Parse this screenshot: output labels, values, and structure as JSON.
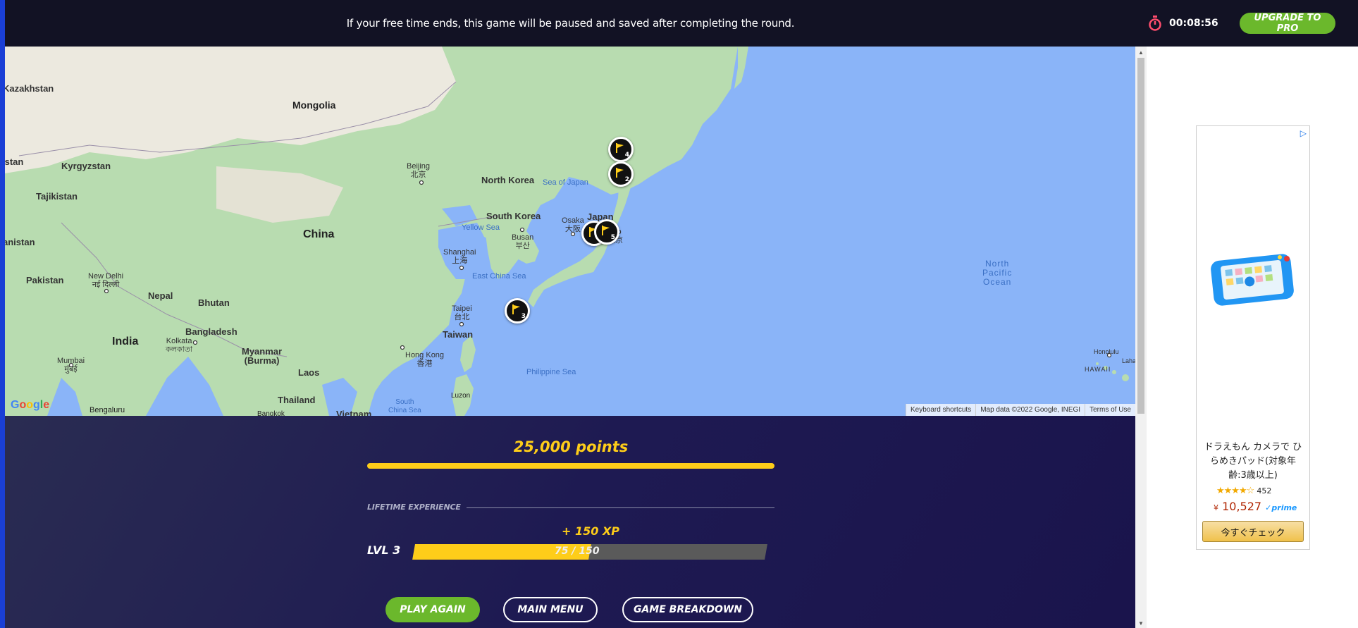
{
  "banner": {
    "message": "If your free time ends, this game will be paused and saved after completing the round.",
    "timer": "00:08:56",
    "timer_icon": "stopwatch-icon",
    "upgrade_label": "UPGRADE TO PRO"
  },
  "map": {
    "labels": {
      "kazakhstan": "Kazakhstan",
      "mongolia": "Mongolia",
      "kyrgyzstan": "Kyrgyzstan",
      "istan": "istan",
      "tajikistan": "Tajikistan",
      "anistan": "anistan",
      "pakistan": "Pakistan",
      "china": "China",
      "north_korea": "North Korea",
      "south_korea": "South Korea",
      "japan": "Japan",
      "nepal": "Nepal",
      "bhutan": "Bhutan",
      "bangladesh": "Bangladesh",
      "india": "India",
      "myanmar": "Myanmar\n(Burma)",
      "laos": "Laos",
      "thailand": "Thailand",
      "vietnam": "Vietnam",
      "taiwan": "Taiwan",
      "luzon": "Luzon",
      "bangkok": "Bangkok",
      "bengaluru": "Bengaluru"
    },
    "cities": {
      "beijing": "Beijing\n北京",
      "shanghai": "Shanghai\n上海",
      "busan": "Busan\n부산",
      "osaka": "Osaka\n大阪",
      "tokyo_partial": "kyo\n東京",
      "taipei": "Taipei\n台北",
      "hong_kong": "Hong Kong\n香港",
      "new_delhi": "New Delhi\nनई दिल्ली",
      "kolkata": "Kolkata\nকলকাতা",
      "mumbai": "Mumbai\nमुंबई",
      "honolulu": "Honolulu",
      "lahaina": "Laha",
      "hawaii": "HAWAII"
    },
    "seas": {
      "sea_of_japan": "Sea of Japan",
      "yellow_sea": "Yellow Sea",
      "east_china_sea": "East China Sea",
      "philippine_sea": "Philippine Sea",
      "south_china_sea": "South\nChina Sea",
      "north_pacific": "North\nPacific\nOcean"
    },
    "pins": [
      {
        "number": "4",
        "icon": "flag-icon"
      },
      {
        "number": "2",
        "icon": "flag-icon"
      },
      {
        "number": "1",
        "icon": "flag-icon"
      },
      {
        "number": "5",
        "icon": "flag-icon"
      },
      {
        "number": "3",
        "icon": "flag-icon"
      }
    ],
    "google_logo": "Google",
    "attribution": {
      "shortcuts": "Keyboard shortcuts",
      "data": "Map data ©2022 Google, INEGI",
      "terms": "Terms of Use"
    }
  },
  "results": {
    "points": "25,000 points",
    "points_fraction": 1.0,
    "xp_heading": "LIFETIME EXPERIENCE",
    "xp_gain": "+ 150 XP",
    "level": "LVL 3",
    "xp_progress": "75 / 150",
    "xp_fraction": 0.5,
    "buttons": {
      "play_again": "PLAY AGAIN",
      "main_menu": "MAIN MENU",
      "breakdown": "GAME BREAKDOWN"
    }
  },
  "ad": {
    "title": "ドラえもん カメラで ひらめきパッド(対象年齢:3歳以上)",
    "stars": "★★★★☆",
    "rating_count": "452",
    "price_symbol": "¥",
    "price": "10,527",
    "prime": "✓prime",
    "cta": "今すぐチェック",
    "choice_icon": "ad-choices-icon"
  },
  "colors": {
    "accent_yellow": "#fecd19",
    "accent_green": "#6bb82c",
    "banner_bg": "#121224",
    "panel_bg": "#1e1a52",
    "water": "#8ab4f8",
    "land": "#b8dcb0"
  }
}
